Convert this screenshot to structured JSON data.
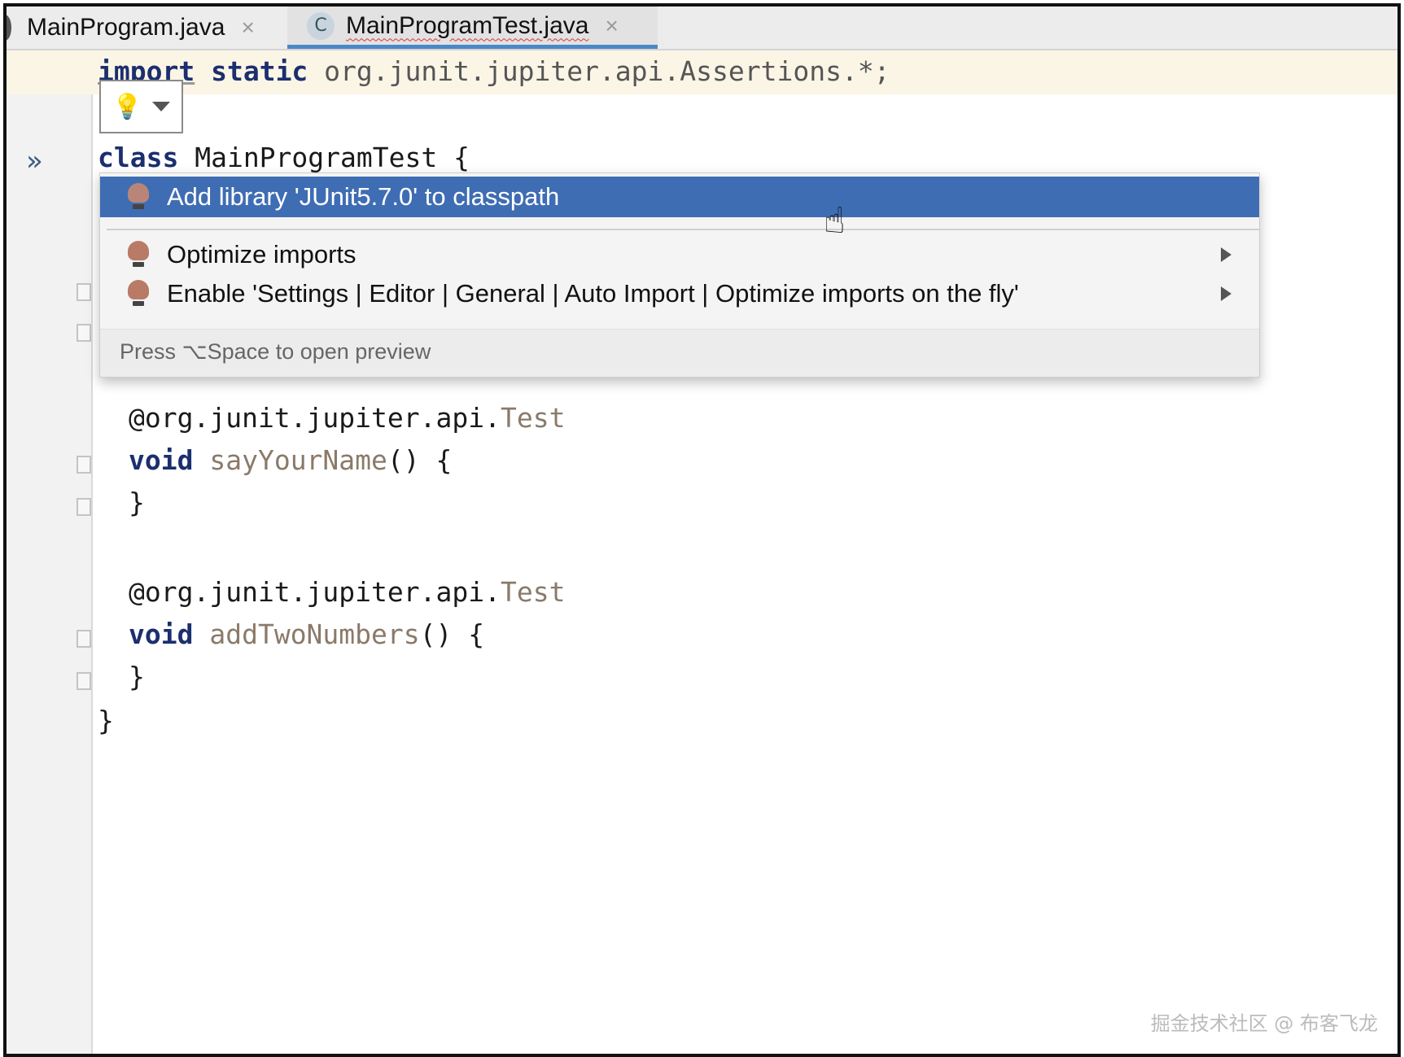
{
  "tabs": [
    {
      "label": "MainProgram.java",
      "close": "×"
    },
    {
      "label": "MainProgramTest.java",
      "close": "×",
      "icon_letter": "C"
    }
  ],
  "gutter": {
    "run_icon": "»"
  },
  "code": {
    "line1": {
      "kw1": "import",
      "kw2": "static",
      "rest": " org.junit.jupiter.api.Assertions.*;"
    },
    "line2": {
      "kw": "class",
      "rest": " MainProgramTest {"
    },
    "ann1": {
      "prefix": "@org.junit.jupiter.api.",
      "name": "Test"
    },
    "m1": {
      "kw": "void",
      "name": " sayYourName",
      "rest": "() {"
    },
    "close1": "}",
    "ann2": {
      "prefix": "@org.junit.jupiter.api.",
      "name": "Test"
    },
    "m2": {
      "kw": "void",
      "name": " addTwoNumbers",
      "rest": "() {"
    },
    "close2": "}",
    "close3": "}"
  },
  "intention_popup": {
    "items": [
      {
        "label": "Add library 'JUnit5.7.0' to classpath",
        "selected": true,
        "submenu": false
      },
      {
        "label": "Optimize imports",
        "selected": false,
        "submenu": true
      },
      {
        "label": "Enable 'Settings | Editor | General | Auto Import | Optimize imports on the fly'",
        "selected": false,
        "submenu": true
      }
    ],
    "footer": "Press ⌥Space to open preview"
  },
  "icons": [
    "bulb-icon",
    "chevron-down-icon",
    "run-icon",
    "close-icon",
    "hand-cursor-icon"
  ],
  "watermark": "掘金技术社区 @ 布客飞龙",
  "colors": {
    "selection": "#3f6db3",
    "keyword": "#1b2f6e",
    "highlight_line": "#fbf5e6"
  }
}
